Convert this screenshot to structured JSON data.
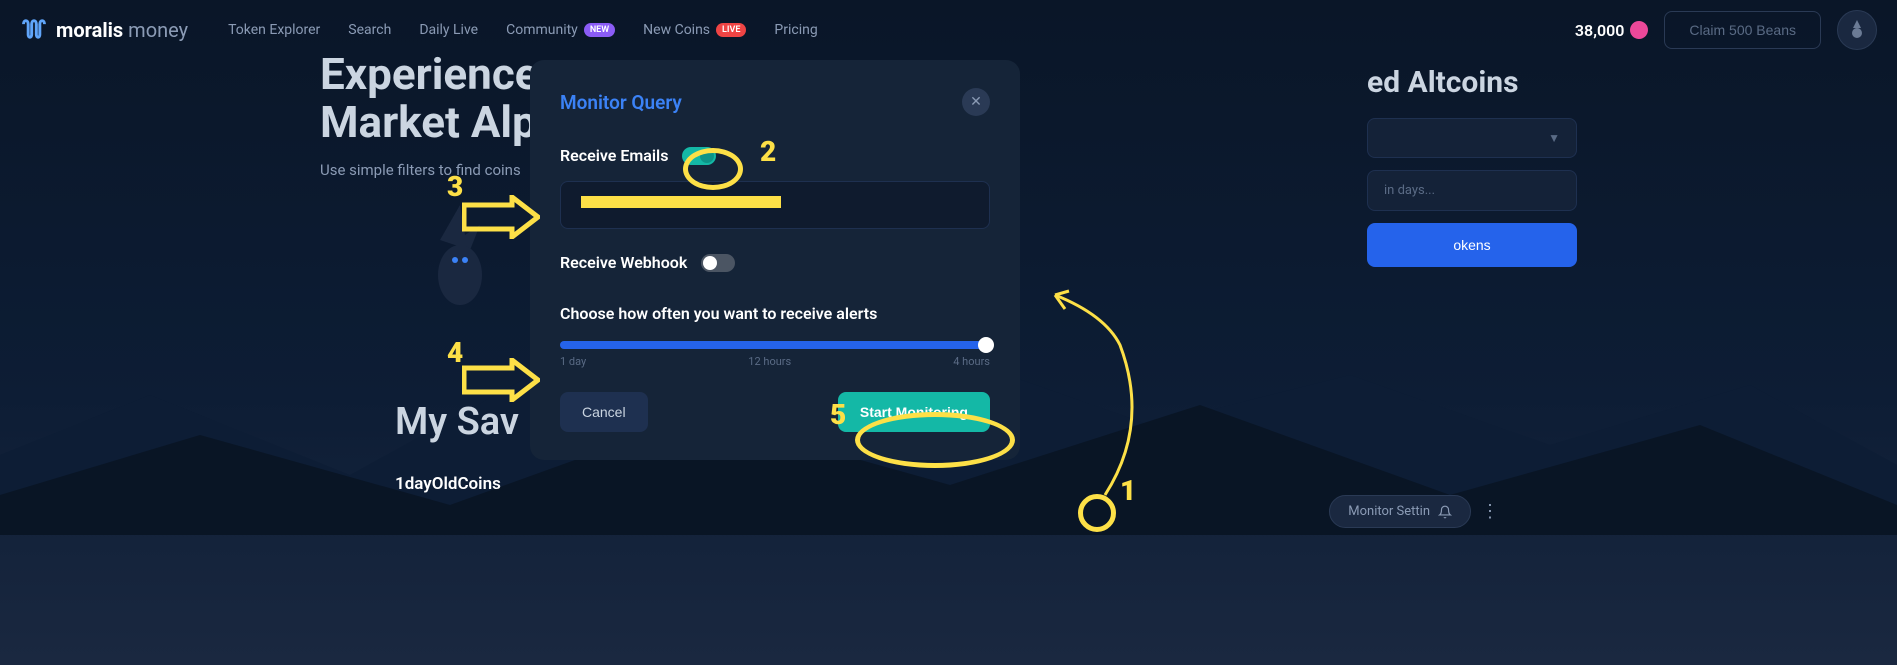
{
  "header": {
    "logo_bold": "moralis",
    "logo_light": "money",
    "nav": {
      "token_explorer": "Token Explorer",
      "search": "Search",
      "daily_live": "Daily Live",
      "community": "Community",
      "community_badge": "NEW",
      "new_coins": "New Coins",
      "new_coins_badge": "LIVE",
      "pricing": "Pricing"
    },
    "beans": "38,000",
    "claim_btn": "Claim 500 Beans"
  },
  "hero": {
    "title_line1": "Experience",
    "title_line2": "Market Alpha",
    "subtitle": "Use simple filters to find coins"
  },
  "side_panel": {
    "title_suffix": "ed Altcoins",
    "input_placeholder": "in days...",
    "button_suffix": "okens"
  },
  "saved": {
    "title": "My Sav",
    "item": "1dayOldCoins",
    "monitor_settings": "Monitor Settin"
  },
  "modal": {
    "title": "Monitor Query",
    "receive_emails": "Receive Emails",
    "receive_webhook": "Receive Webhook",
    "alerts_label": "Choose how often you want to receive alerts",
    "slider": {
      "left": "1 day",
      "mid": "12 hours",
      "right": "4 hours"
    },
    "cancel": "Cancel",
    "start": "Start Monitoring"
  },
  "annotations": {
    "n1": "1",
    "n2": "2",
    "n3": "3",
    "n4": "4",
    "n5": "5"
  }
}
